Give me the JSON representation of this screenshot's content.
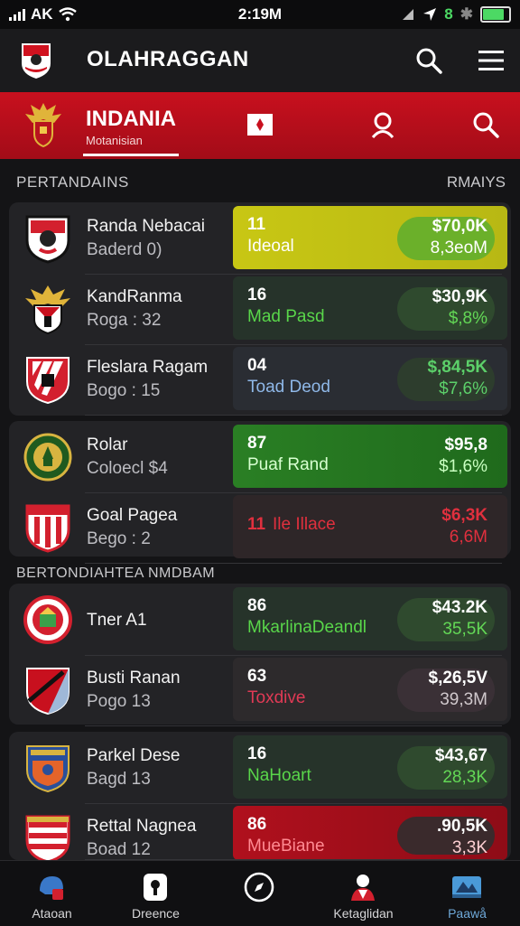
{
  "status_bar": {
    "carrier": "AK",
    "time": "2:19M",
    "right_number": "8"
  },
  "app_bar": {
    "title": "OLAHRAGGAN"
  },
  "banner": {
    "title": "INDANIA",
    "subtitle": "Motanisian"
  },
  "sections": [
    {
      "title": "PERTANDAINS",
      "right": "RMAIYS"
    },
    {
      "title": "BERTONDIAHTEA NMDBAM",
      "right": ""
    }
  ],
  "matches": [
    {
      "name": "Randa Nebacai",
      "sub": "Baderd 0)",
      "number": "11",
      "label": "Ideoal",
      "value1": "$70,0K",
      "value2": "8,3eoM",
      "theme": "yellow",
      "crest": "eagle-crest-icon"
    },
    {
      "name": "KandRanma",
      "sub": "Roga : 32",
      "number": "16",
      "label": "Mad Pasd",
      "value1": "$30,9K",
      "value2": "$,8%",
      "theme": "dark-green",
      "crest": "garuda-crest-icon"
    },
    {
      "name": "Fleslara Ragam",
      "sub": "Bogo : 15",
      "number": "04",
      "label": "Toad Deod",
      "value1": "$,84,5K",
      "value2": "$7,6%",
      "theme": "dark-blue",
      "crest": "striped-crest-icon"
    },
    {
      "name": "Rolar",
      "sub": "Coloecl $4",
      "number": "87",
      "label": "Puaf Rand",
      "value1": "$95,8",
      "value2": "$1,6%",
      "theme": "green",
      "crest": "round-green-crest-icon"
    },
    {
      "name": "Goal Pagea",
      "sub": "Bego : 2",
      "number": "11",
      "label": "Ile Illace",
      "value1": "$6,3K",
      "value2": "6,6M",
      "theme": "dark-red",
      "crest": "red-stripe-crest-icon"
    },
    {
      "name": "Tner A1",
      "sub": "",
      "number": "86",
      "label": "MkarlinaDeandl",
      "value1": "$43.2K",
      "value2": "35,5K",
      "theme": "dark-green",
      "crest": "round-red-crest-icon"
    },
    {
      "name": "Busti Ranan",
      "sub": "Pogo 13",
      "number": "63",
      "label": "Toxdive",
      "value1": "$,26,5V",
      "value2": "39,3M",
      "theme": "dark-pink",
      "crest": "diagonal-crest-icon"
    },
    {
      "name": "Parkel Dese",
      "sub": "Bagd 13",
      "number": "16",
      "label": "NaHoart",
      "value1": "$43,67",
      "value2": "28,3K",
      "theme": "dark-green",
      "crest": "blue-orange-crest-icon"
    },
    {
      "name": "Rettal Nagnea",
      "sub": "Boad 12",
      "number": "86",
      "label": "MueBiane",
      "value1": ".90,5K",
      "value2": "3,3K",
      "theme": "red",
      "crest": "red-white-crest-icon"
    }
  ],
  "bottom_nav": [
    {
      "label": "Ataoan",
      "icon": "helmet-icon"
    },
    {
      "label": "Dreence",
      "icon": "lock-icon"
    },
    {
      "label": "",
      "icon": "compass-icon"
    },
    {
      "label": "Ketaglidan",
      "icon": "player-icon"
    },
    {
      "label": "Paawå",
      "icon": "stadium-icon"
    }
  ],
  "colors": {
    "accent_red": "#c8101e",
    "bg": "#141416",
    "card": "#232326",
    "yellow": "#c9c817",
    "green": "#1f7a1f"
  }
}
